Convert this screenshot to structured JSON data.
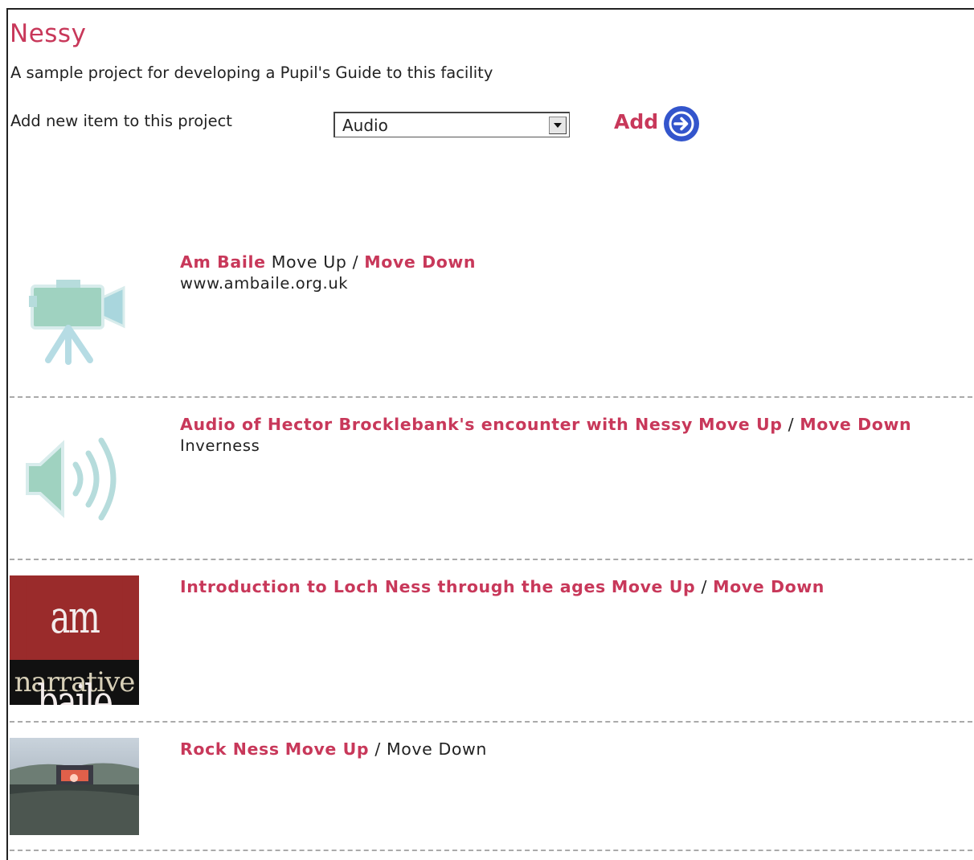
{
  "project": {
    "title": "Nessy",
    "description": "A sample project for developing a Pupil's Guide to this facility"
  },
  "add_item": {
    "label": "Add new item to this project",
    "selected_type": "Audio",
    "button_label": "Add"
  },
  "items": [
    {
      "title": "Am Baile",
      "move_up": "Move Up",
      "separator": "/",
      "move_down": "Move Down",
      "subtitle": "www.ambaile.org.uk",
      "thumbnail": "video-camera-icon"
    },
    {
      "title": "Audio of Hector Brocklebank's encounter with Nessy",
      "move_up": "Move Up",
      "separator": "/",
      "move_down": "Move Down",
      "subtitle": "Inverness",
      "thumbnail": "speaker-icon"
    },
    {
      "title": "Introduction to Loch Ness through the ages",
      "move_up": "Move Up",
      "separator": "/",
      "move_down": "Move Down",
      "subtitle": "",
      "thumbnail": "ambaile-narrative-logo",
      "logo_top": "am baile",
      "logo_bottom": "narrative"
    },
    {
      "title": "Rock Ness",
      "move_up": "Move Up",
      "separator": "/",
      "move_down": "Move Down",
      "subtitle": "",
      "thumbnail": "concert-photo"
    }
  ],
  "colors": {
    "accent": "#c8385a",
    "button_blue": "#3355cc",
    "separator": "#aaaaaa"
  }
}
